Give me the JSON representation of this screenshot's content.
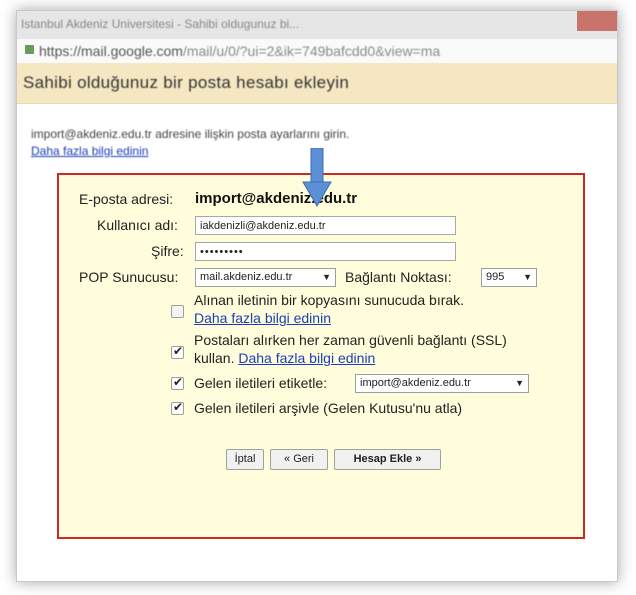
{
  "browser": {
    "window_title": "Istanbul Akdeniz Universitesi - Sahibi oldugunuz bi...",
    "url_host": "https://mail.google.com",
    "url_path": "/mail/u/0/?ui=2&ik=749bafcdd0&view=ma"
  },
  "dialog": {
    "title": "Sahibi olduğunuz bir posta hesabı ekleyin",
    "instruction": "import@akdeniz.edu.tr adresine ilişkin posta ayarlarını girin.",
    "instruction_link": "Daha fazla bilgi edinin"
  },
  "form": {
    "email_label": "E-posta adresi:",
    "email_value": "import@akdeniz.edu.tr",
    "username_label": "Kullanıcı adı:",
    "username_value": "iakdenizli@akdeniz.edu.tr",
    "password_label": "Şifre:",
    "password_value": "•••••••••",
    "pop_label": "POP Sunucusu:",
    "pop_value": "mail.akdeniz.edu.tr",
    "port_label": "Bağlantı Noktası:",
    "port_value": "995",
    "opt1_text": "Alınan iletinin bir kopyasını sunucuda bırak.",
    "opt1_link": "Daha fazla bilgi edinin",
    "opt1_checked": false,
    "opt2_text_a": "Postaları alırken her zaman güvenli bağlantı (SSL)",
    "opt2_text_b": "kullan.",
    "opt2_link": "Daha fazla bilgi edinin",
    "opt2_checked": true,
    "opt3_text": "Gelen iletileri etiketle:",
    "opt3_select": "import@akdeniz.edu.tr",
    "opt3_checked": true,
    "opt4_text": "Gelen iletileri arşivle (Gelen Kutusu'nu atla)",
    "opt4_checked": true
  },
  "buttons": {
    "cancel": "İptal",
    "back": "« Geri",
    "add": "Hesap Ekle »"
  },
  "colors": {
    "highlight_border": "#cf2626",
    "arrow": "#5b8fd6",
    "link": "#1a3eb8",
    "header_bg": "#f5e7c2",
    "form_bg": "#fffddb"
  }
}
